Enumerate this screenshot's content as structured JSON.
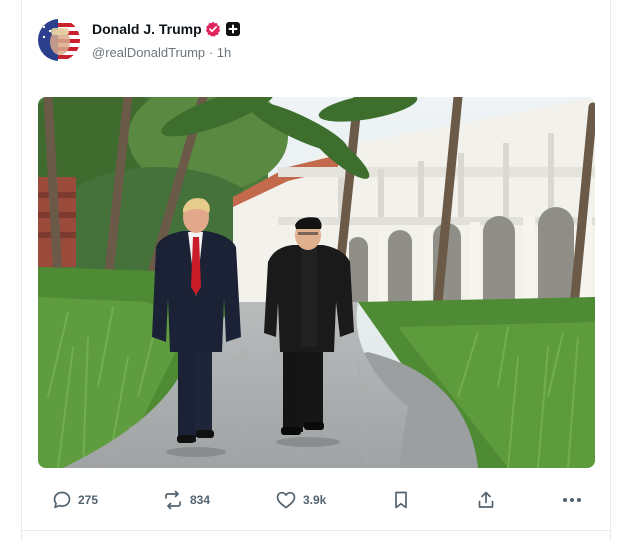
{
  "post": {
    "author": {
      "display_name": "Donald J. Trump",
      "handle": "@realDonaldTrump",
      "separator": "·",
      "time": "1h",
      "verified": true,
      "avatar_icon": "flag-face-avatar"
    },
    "media": {
      "type": "photo",
      "icon": "photo-media"
    },
    "actions": {
      "replies": "275",
      "reposts": "834",
      "likes": "3.9k",
      "icons": [
        "reply-icon",
        "repost-icon",
        "like-icon",
        "bookmark-icon",
        "share-icon",
        "more-icon"
      ]
    }
  },
  "colors": {
    "verified_badge": "#e0245e",
    "secondary_text": "#536471",
    "border": "#ececec"
  }
}
